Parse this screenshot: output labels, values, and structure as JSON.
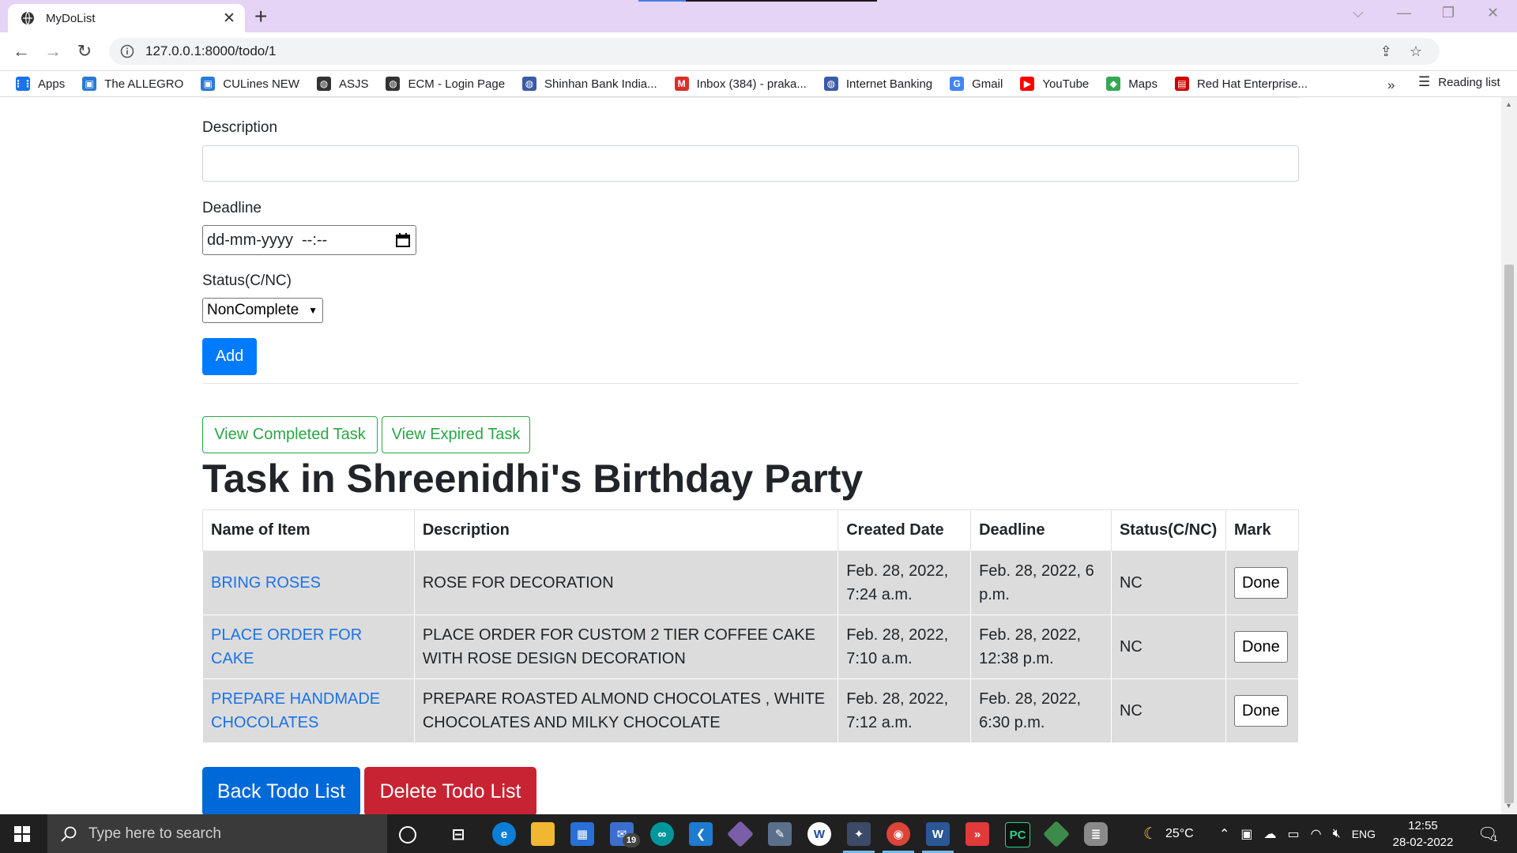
{
  "browser": {
    "tab_title": "MyDoList",
    "url": "127.0.0.1:8000/todo/1",
    "bookmarks": [
      {
        "label": "Apps",
        "icon": "apps-grid-icon",
        "color": "#1a73e8"
      },
      {
        "label": "The ALLEGRO",
        "icon": "allegro-icon",
        "color": "#2a7bd4"
      },
      {
        "label": "CULines NEW",
        "icon": "culines-icon",
        "color": "#2a7bd4"
      },
      {
        "label": "ASJS",
        "icon": "globe-icon",
        "color": "#333333"
      },
      {
        "label": "ECM - Login Page",
        "icon": "globe-icon",
        "color": "#333333"
      },
      {
        "label": "Shinhan Bank India...",
        "icon": "shinhan-icon",
        "color": "#3b5ba5"
      },
      {
        "label": "Inbox (384) - praka...",
        "icon": "gmail-icon",
        "color": "#d93025"
      },
      {
        "label": "Internet Banking",
        "icon": "bank-icon",
        "color": "#3b5ba5"
      },
      {
        "label": "Gmail",
        "icon": "google-icon",
        "color": "#4285f4"
      },
      {
        "label": "YouTube",
        "icon": "youtube-icon",
        "color": "#ff0000"
      },
      {
        "label": "Maps",
        "icon": "maps-icon",
        "color": "#34a853"
      },
      {
        "label": "Red Hat Enterprise...",
        "icon": "redhat-icon",
        "color": "#cc0000"
      }
    ],
    "more_bookmarks": "»",
    "reading_list": "Reading list"
  },
  "form": {
    "description_label": "Description",
    "description_value": "",
    "deadline_label": "Deadline",
    "deadline_placeholder": "dd-mm-yyyy  --:--",
    "status_label": "Status(C/NC)",
    "status_selected": "NonComplete",
    "add_label": "Add"
  },
  "filters": {
    "completed_label": "View Completed Task",
    "expired_label": "View Expired Task"
  },
  "heading": "Task in Shreenidhi's Birthday Party",
  "table": {
    "headers": [
      "Name of Item",
      "Description",
      "Created Date",
      "Deadline",
      "Status(C/NC)",
      "Mark"
    ],
    "rows": [
      {
        "name": "BRING ROSES",
        "description": "ROSE FOR DECORATION",
        "created": "Feb. 28, 2022, 7:24 a.m.",
        "deadline": "Feb. 28, 2022, 6 p.m.",
        "status": "NC",
        "mark": "Done"
      },
      {
        "name": "PLACE ORDER FOR CAKE",
        "description": "PLACE ORDER FOR CUSTOM 2 TIER COFFEE CAKE WITH ROSE DESIGN DECORATION",
        "created": "Feb. 28, 2022, 7:10 a.m.",
        "deadline": "Feb. 28, 2022, 12:38 p.m.",
        "status": "NC",
        "mark": "Done"
      },
      {
        "name": "PREPARE HANDMADE CHOCOLATES",
        "description": "PREPARE ROASTED ALMOND CHOCOLATES , WHITE CHOCOLATES AND MILKY CHOCOLATE",
        "created": "Feb. 28, 2022, 7:12 a.m.",
        "deadline": "Feb. 28, 2022, 6:30 p.m.",
        "status": "NC",
        "mark": "Done"
      }
    ]
  },
  "actions": {
    "back_label": "Back Todo List",
    "delete_label": "Delete Todo List"
  },
  "taskbar": {
    "search_placeholder": "Type here to search",
    "mail_badge": "19",
    "weather": "25°C",
    "language": "ENG",
    "time": "12:55",
    "date": "28-02-2022",
    "notification_count": "1"
  },
  "colors": {
    "primary": "#007bff",
    "success": "#28a745",
    "danger": "#c82333",
    "link": "#1a73e8",
    "row_bg": "#dcdcdc"
  }
}
